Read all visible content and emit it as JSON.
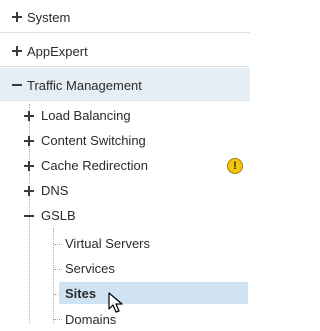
{
  "nav": {
    "system": "System",
    "appexpert": "AppExpert",
    "traffic_management": "Traffic Management",
    "traffic_children": {
      "load_balancing": "Load Balancing",
      "content_switching": "Content Switching",
      "cache_redirection": "Cache Redirection",
      "dns": "DNS",
      "gslb": "GSLB"
    },
    "gslb_children": {
      "virtual_servers": "Virtual Servers",
      "services": "Services",
      "sites": "Sites",
      "domains": "Domains"
    },
    "selected_item": "Sites"
  },
  "icons": {
    "expand": "plus-icon",
    "collapse": "minus-icon",
    "warning": "warning-icon",
    "pointer": "cursor-icon"
  },
  "badges": {
    "warning_symbol": "!"
  },
  "colors": {
    "selected_bg": "#cfe3f3",
    "expanded_header_bg": "#e6eef5",
    "warning": "#f1c40f"
  }
}
